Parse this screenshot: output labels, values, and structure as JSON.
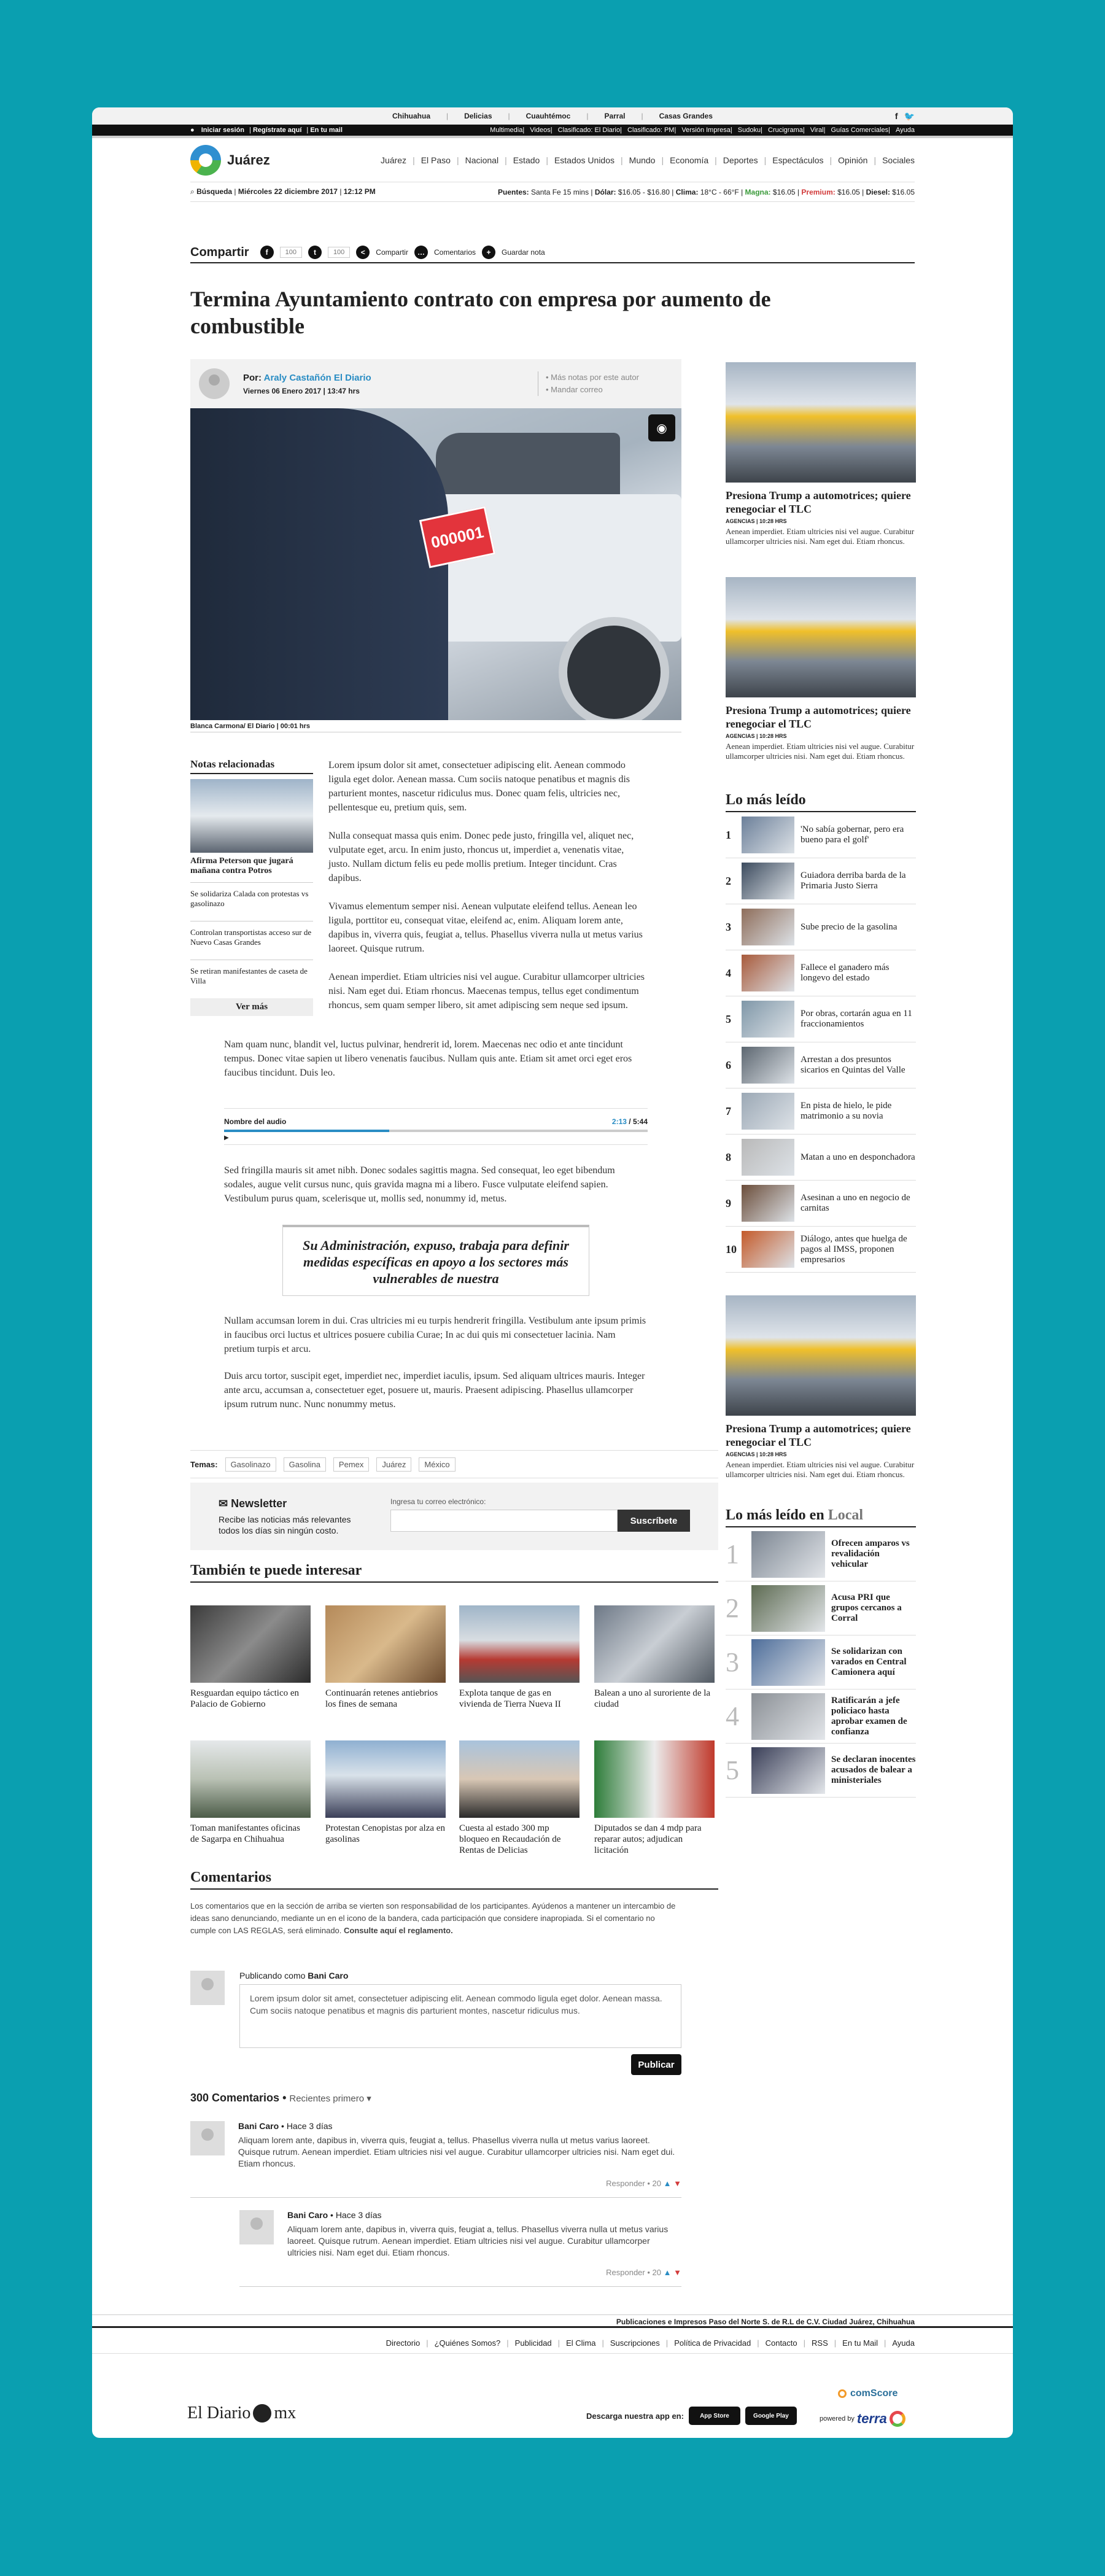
{
  "top": {
    "cities": [
      "Chihuahua",
      "Delicias",
      "Cuauhtémoc",
      "Parral",
      "Casas Grandes"
    ],
    "social": [
      "f",
      "🐦"
    ]
  },
  "blackbar": {
    "login": "Iniciar sesión",
    "register": "Regístrate aquí",
    "mail": "En tu mail",
    "links": [
      "Multimedia",
      "Videos",
      "Clasificado: El Diario",
      "Clasificado: PM",
      "Versión Impresa",
      "Sudoku",
      "Crucigrama",
      "Viral",
      "Guías Comerciales",
      "Ayuda"
    ]
  },
  "header": {
    "logo_text": "Juárez",
    "nav": [
      "Juárez",
      "El Paso",
      "Nacional",
      "Estado",
      "Estados Unidos",
      "Mundo",
      "Economía",
      "Deportes",
      "Espectáculos",
      "Opinión",
      "Sociales"
    ]
  },
  "infobar": {
    "search": "Búsqueda",
    "date": "Miércoles 22 diciembre 2017",
    "time": "12:12 PM",
    "puentes_label": "Puentes:",
    "puentes": "Santa Fe 15 mins",
    "dolar_label": "Dólar:",
    "dolar": "$16.05 - $16.80",
    "clima_label": "Clima:",
    "clima": "18°C - 66°F",
    "magna_label": "Magna:",
    "magna": "$16.05",
    "premium_label": "Premium:",
    "premium": "$16.05",
    "diesel_label": "Diesel:",
    "diesel": "$16.05"
  },
  "share": {
    "label": "Compartir",
    "fb_count": "100",
    "tw_count": "100",
    "share_label": "Compartir",
    "comments_label": "Comentarios",
    "save_label": "Guardar nota"
  },
  "article": {
    "title": "Termina Ayuntamiento contrato con empresa por aumento de combustible",
    "by_prefix": "Por:",
    "author": "Araly Castañón El Diario",
    "date": "Viernes 06 Enero 2017 | 13:47 hrs",
    "more_author": "• Más notas por este autor",
    "mail": "• Mandar correo",
    "tag_text": "000001",
    "caption": "Blanca Carmona/ El Diario | 00:01 hrs",
    "p1": "Lorem ipsum dolor sit amet, consectetuer adipiscing elit. Aenean commodo ligula eget dolor. Aenean massa. Cum sociis natoque penatibus et magnis dis parturient montes, nascetur ridiculus mus. Donec quam felis, ultricies nec, pellentesque eu, pretium quis, sem.",
    "p2": "Nulla consequat massa quis enim. Donec pede justo, fringilla vel, aliquet nec, vulputate eget, arcu. In enim justo, rhoncus ut, imperdiet a, venenatis vitae, justo. Nullam dictum felis eu pede mollis pretium. Integer tincidunt. Cras dapibus.",
    "p3": "Vivamus elementum semper nisi. Aenean vulputate eleifend tellus. Aenean leo ligula, porttitor eu, consequat vitae, eleifend ac, enim. Aliquam lorem ante, dapibus in, viverra quis, feugiat a, tellus. Phasellus viverra nulla ut metus varius laoreet. Quisque rutrum.",
    "p4": "Aenean imperdiet. Etiam ultricies nisi vel augue. Curabitur ullamcorper ultricies nisi. Nam eget dui. Etiam rhoncus. Maecenas tempus, tellus eget condimentum rhoncus, sem quam semper libero, sit amet adipiscing sem neque sed ipsum.",
    "p5": "Nam quam nunc, blandit vel, luctus pulvinar, hendrerit id, lorem. Maecenas nec odio et ante tincidunt tempus. Donec vitae sapien ut libero venenatis faucibus. Nullam quis ante. Etiam sit amet orci eget eros faucibus tincidunt. Duis leo.",
    "p6": "Sed fringilla mauris sit amet nibh. Donec sodales sagittis magna. Sed consequat, leo eget bibendum sodales, augue velit cursus nunc, quis gravida magna mi a libero. Fusce vulputate eleifend sapien. Vestibulum purus quam, scelerisque ut, mollis sed, nonummy id, metus.",
    "quote": "Su Administración, expuso, trabaja para definir medidas específicas en apoyo a los sectores más vulnerables de nuestra",
    "p7": "Nullam accumsan lorem in dui. Cras ultricies mi eu turpis hendrerit fringilla. Vestibulum ante ipsum primis in faucibus orci luctus et ultrices posuere cubilia Curae; In ac dui quis mi consectetuer lacinia. Nam pretium turpis et arcu.",
    "p8": "Duis arcu tortor, suscipit eget, imperdiet nec, imperdiet iaculis, ipsum. Sed aliquam ultrices mauris. Integer ante arcu, accumsan a, consectetuer eget, posuere ut, mauris. Praesent adipiscing. Phasellus ullamcorper ipsum rutrum nunc. Nunc nonummy metus."
  },
  "audio": {
    "label": "Nombre del audio",
    "current": "2:13",
    "total": "5:44",
    "progress": 0.39
  },
  "related": {
    "title": "Notas relacionadas",
    "lead": "Afirma Peterson que jugará mañana contra Potros",
    "items": [
      "Se solidariza Calada con protestas vs gasolinazo",
      "Controlan transportistas acceso sur de Nuevo Casas Grandes",
      "Se retiran manifestantes de caseta de Villa"
    ],
    "more": "Ver más"
  },
  "temas": {
    "label": "Temas:",
    "tags": [
      "Gasolinazo",
      "Gasolina",
      "Pemex",
      "Juárez",
      "México"
    ]
  },
  "newsletter": {
    "title": "Newsletter",
    "desc": "Recibe las noticias más relevantes todos los días sin ningún costo.",
    "input_label": "Ingresa tu correo electrónico:",
    "button": "Suscríbete"
  },
  "tambien": {
    "title": "También te puede interesar",
    "cards": [
      "Resguardan equipo táctico en Palacio de Gobierno",
      "Continuarán retenes antiebrios los fines de semana",
      "Explota tanque de gas en vivienda de Tierra Nueva II",
      "Balean a uno al suroriente de la ciudad",
      "Toman manifestantes oficinas de Sagarpa en Chihuahua",
      "Protestan Cenopistas por alza en gasolinas",
      "Cuesta al estado 300 mp bloqueo en Recaudación de Rentas de Delicias",
      "Diputados se dan 4 mdp para reparar autos; adjudican licitación"
    ]
  },
  "comments": {
    "title": "Comentarios",
    "intro": "Los comentarios que en la sección de arriba se vierten son responsabilidad de los participantes. Ayúdenos a mantener un intercambio de ideas sano denunciando, mediante un en el icono de la bandera, cada participación que considere inapropiada. Si el comentario no cumple con LAS REGLAS, será eliminado.",
    "intro_link": "Consulte aquí el reglamento.",
    "publishing_as": "Publicando como",
    "user": "Bani Caro",
    "draft": "Lorem ipsum dolor sit amet, consectetuer adipiscing elit. Aenean commodo ligula eget dolor. Aenean massa. Cum sociis natoque penatibus et magnis dis parturient montes, nascetur ridiculus mus.",
    "publish": "Publicar",
    "count": "300 Comentarios",
    "sort": "Recientes primero",
    "list": [
      {
        "name": "Bani Caro",
        "time": "Hace 3 días",
        "text": "Aliquam lorem ante, dapibus in, viverra quis, feugiat a, tellus. Phasellus viverra nulla ut metus varius laoreet. Quisque rutrum. Aenean imperdiet. Etiam ultricies nisi vel augue. Curabitur ullamcorper ultricies nisi. Nam eget dui. Etiam rhoncus.",
        "reply": "Responder",
        "likes": "20"
      },
      {
        "name": "Bani Caro",
        "time": "Hace 3 días",
        "text": "Aliquam lorem ante, dapibus in, viverra quis, feugiat a, tellus. Phasellus viverra nulla ut metus varius laoreet. Quisque rutrum. Aenean imperdiet. Etiam ultricies nisi vel augue. Curabitur ullamcorper ultricies nisi. Nam eget dui. Etiam rhoncus.",
        "reply": "Responder",
        "likes": "20"
      }
    ]
  },
  "sidebar": {
    "stories": [
      {
        "headline": "Presiona Trump a automotrices; quiere renegociar el TLC",
        "agency": "AGENCIAS | 10:28 HRS",
        "excerpt": "Aenean imperdiet. Etiam ultricies nisi vel augue. Curabitur ullamcorper ultricies nisi. Nam eget dui. Etiam rhoncus."
      },
      {
        "headline": "Presiona Trump a automotrices; quiere renegociar el TLC",
        "agency": "AGENCIAS | 10:28 HRS",
        "excerpt": "Aenean imperdiet. Etiam ultricies nisi vel augue. Curabitur ullamcorper ultricies nisi. Nam eget dui. Etiam rhoncus."
      },
      {
        "headline": "Presiona Trump a automotrices; quiere renegociar el TLC",
        "agency": "AGENCIAS | 10:28 HRS",
        "excerpt": "Aenean imperdiet. Etiam ultricies nisi vel augue. Curabitur ullamcorper ultricies nisi. Nam eget dui. Etiam rhoncus."
      }
    ],
    "masleido_title": "Lo más leído",
    "masleido": [
      "'No sabía gobernar, pero era bueno para el golf'",
      "Guiadora derriba barda de la Primaria Justo Sierra",
      "Sube precio de la gasolina",
      "Fallece el ganadero más longevo del estado",
      "Por obras, cortarán agua en 11 fraccionamientos",
      "Arrestan a dos presuntos sicarios en Quintas del Valle",
      "En pista de hielo, le pide matrimonio a su novia",
      "Matan a uno en desponchadora",
      "Asesinan a uno en negocio de carnitas",
      "Diálogo, antes que huelga de pagos al IMSS, proponen empresarios"
    ],
    "local_title": "Lo más leído en",
    "local_word": "Local",
    "local": [
      "Ofrecen amparos vs revalidación vehicular",
      "Acusa PRI que grupos cercanos a Corral",
      "Se solidarizan con varados en Central Camionera aquí",
      "Ratificarán a jefe policiaco hasta aprobar examen de confianza",
      "Se declaran inocentes acusados de balear a ministeriales"
    ]
  },
  "footer": {
    "company": "Publicaciones e Impresos Paso del Norte S. de R.L de C.V. Ciudad Juárez, Chihuahua",
    "links": [
      "Directorio",
      "¿Quiénes Somos?",
      "Publicidad",
      "El Clima",
      "Suscripciones",
      "Política de Privacidad",
      "Contacto",
      "RSS",
      "En tu Mail",
      "Ayuda"
    ],
    "logo_a": "El Diario",
    "logo_b": "mx",
    "download": "Descarga nuestra app en:",
    "appstore": "App Store",
    "googleplay": "Google Play",
    "comscore": "comScore",
    "powered": "powered by",
    "terra": "terra"
  }
}
